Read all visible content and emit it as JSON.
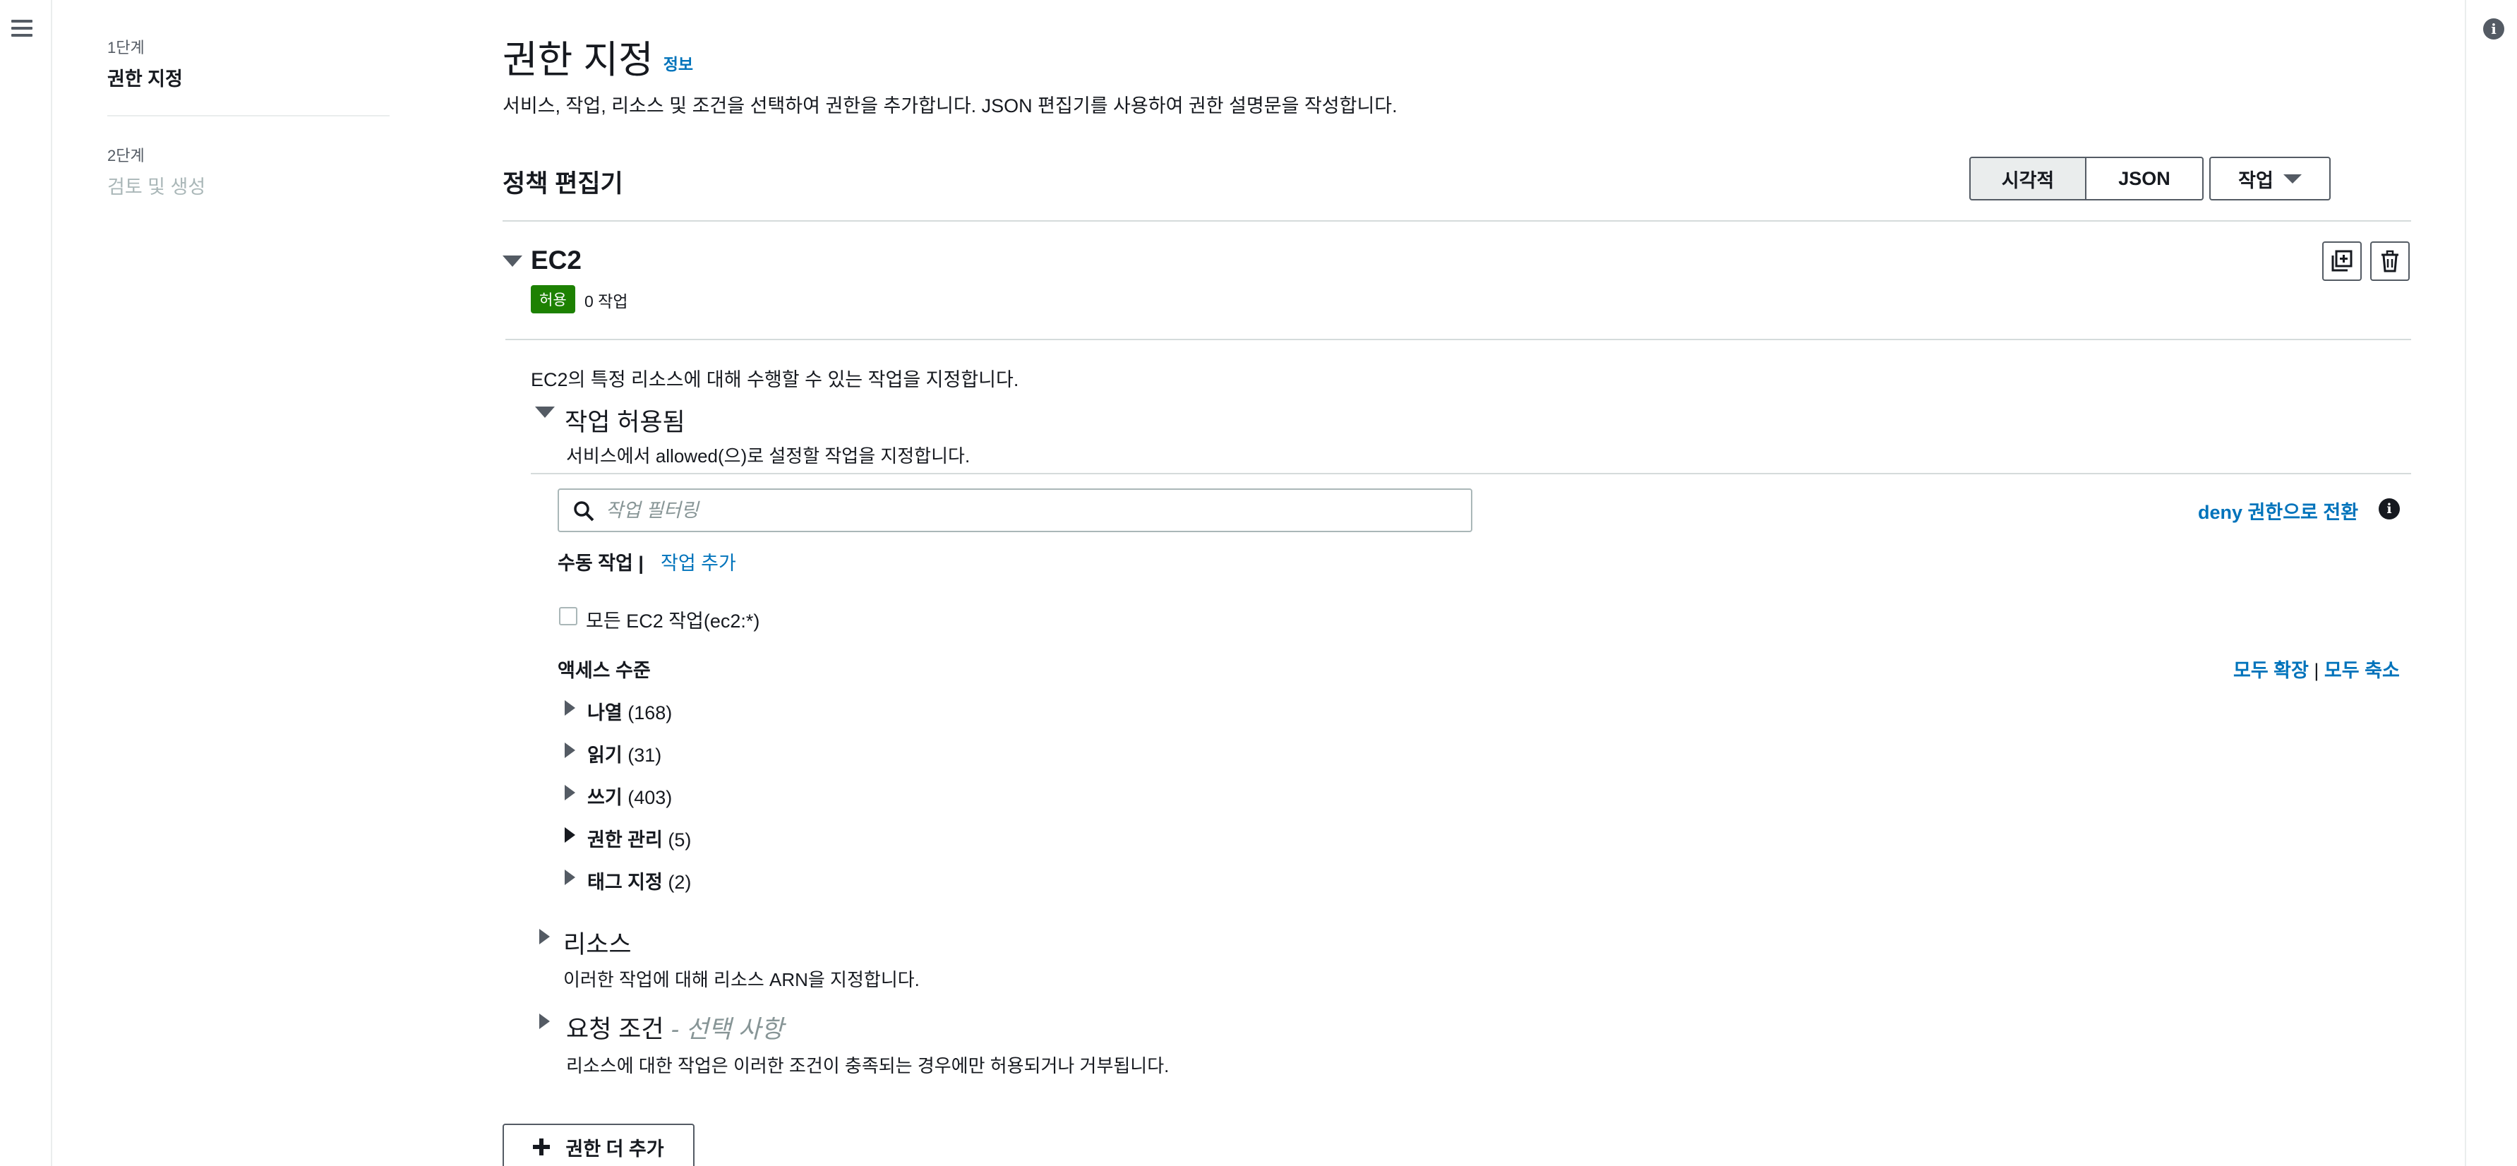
{
  "steps": [
    {
      "label": "1단계",
      "title": "권한 지정"
    },
    {
      "label": "2단계",
      "title": "검토 및 생성"
    }
  ],
  "header": {
    "title": "권한 지정",
    "info_link": "정보",
    "description": "서비스, 작업, 리소스 및 조건을 선택하여 권한을 추가합니다. JSON 편집기를 사용하여 권한 설명문을 작성합니다."
  },
  "editor": {
    "title": "정책 편집기",
    "tabs": {
      "visual": "시각적",
      "json": "JSON"
    },
    "actions_label": "작업"
  },
  "service": {
    "name": "EC2",
    "effect_badge": "허용",
    "action_count": "0 작업",
    "description": "EC2의 특정 리소스에 대해 수행할 수 있는 작업을 지정합니다."
  },
  "actions_allowed": {
    "title": "작업 허용됨",
    "description": "서비스에서 allowed(으)로 설정할 작업을 지정합니다.",
    "filter_placeholder": "작업 필터링",
    "switch_deny": "deny 권한으로 전환",
    "manual_label": "수동 작업 |",
    "add_action": "작업 추가",
    "all_actions_label": "모든 EC2 작업(ec2:*)",
    "access_level_title": "액세스 수준",
    "expand_all": "모두 확장",
    "separator": "|",
    "collapse_all": "모두 축소",
    "levels": [
      {
        "name": "나열",
        "count": "(168)"
      },
      {
        "name": "읽기",
        "count": "(31)"
      },
      {
        "name": "쓰기",
        "count": "(403)"
      },
      {
        "name": "권한 관리",
        "count": "(5)"
      },
      {
        "name": "태그 지정",
        "count": "(2)"
      }
    ]
  },
  "resources": {
    "title": "리소스",
    "description": "이러한 작업에 대해 리소스 ARN을 지정합니다."
  },
  "request_conditions": {
    "title": "요청 조건",
    "optional": "- 선택 사항",
    "description": "리소스에 대한 작업은 이러한 조건이 충족되는 경우에만 허용되거나 거부됩니다."
  },
  "add_permissions": "권한 더 추가",
  "colors": {
    "link": "#0073bb",
    "allow_badge": "#1d8102",
    "border": "#d5dbdb"
  },
  "icons": [
    "menu-icon",
    "info-icon",
    "search-icon",
    "duplicate-icon",
    "trash-icon",
    "plus-icon"
  ]
}
